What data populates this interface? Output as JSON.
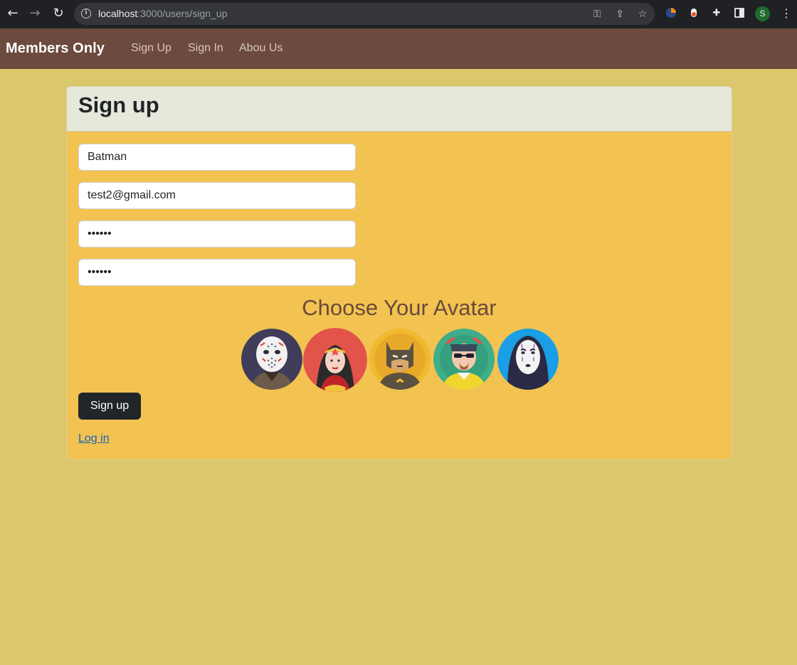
{
  "browser": {
    "url_host": "localhost",
    "url_path": ":3000/users/sign_up",
    "profile_initial": "S"
  },
  "navbar": {
    "brand": "Members Only",
    "links": [
      {
        "label": "Sign Up"
      },
      {
        "label": "Sign In"
      },
      {
        "label": "Abou Us"
      }
    ]
  },
  "form": {
    "title": "Sign up",
    "name_value": "Batman",
    "email_value": "test2@gmail.com",
    "password_value": "••••••",
    "password_confirm_value": "••••••",
    "avatar_title": "Choose Your Avatar",
    "avatars": [
      "jason-avatar",
      "wonder-woman-avatar",
      "batman-avatar",
      "heisenberg-avatar",
      "no-face-avatar"
    ],
    "submit_label": "Sign up",
    "login_link": "Log in"
  },
  "colors": {
    "page_bg": "#dcc86c",
    "navbar_bg": "#6c4a3e",
    "card_bg": "#f2c351",
    "card_header_bg": "#e6e8da",
    "button_bg": "#212529",
    "link": "#1e62b8"
  }
}
